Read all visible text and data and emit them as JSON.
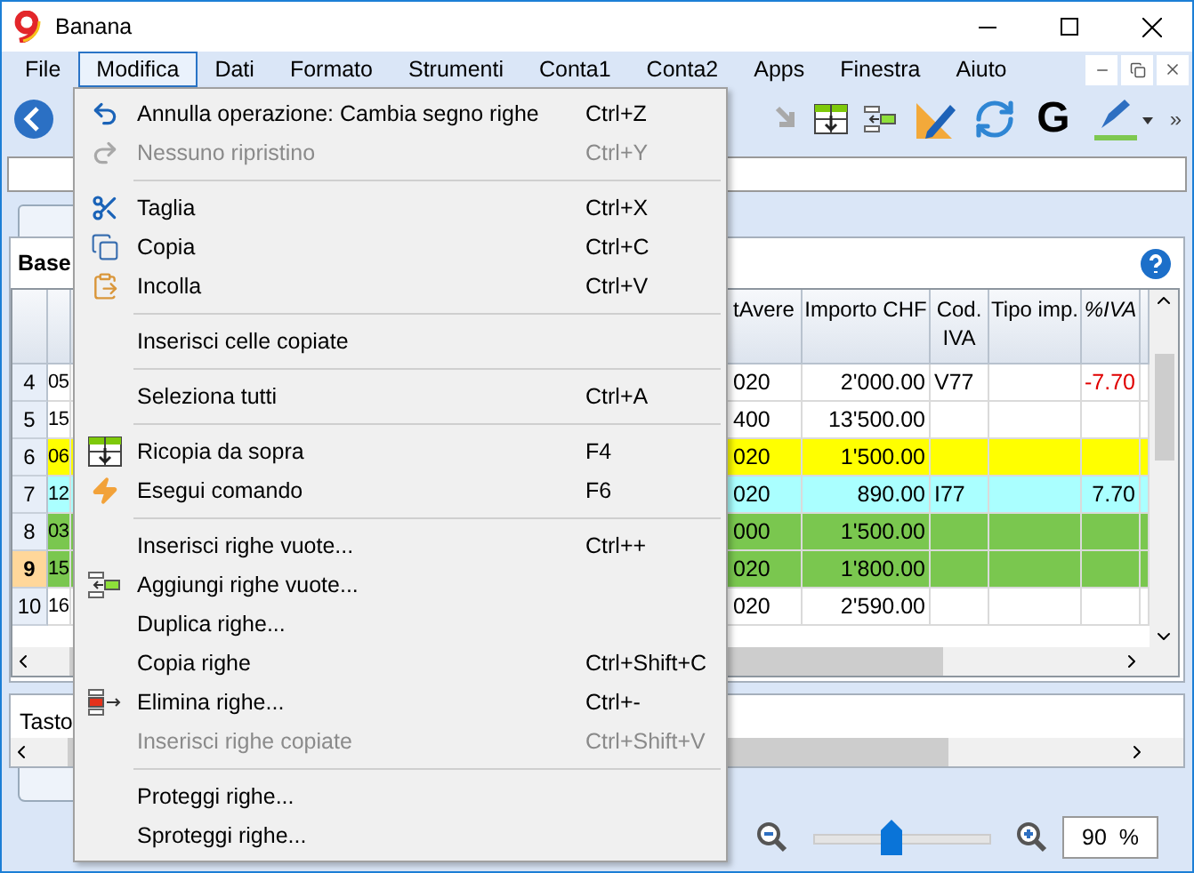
{
  "window": {
    "title": "Banana"
  },
  "menubar": [
    {
      "label": "File",
      "selected": false
    },
    {
      "label": "Modifica",
      "selected": true
    },
    {
      "label": "Dati",
      "selected": false
    },
    {
      "label": "Formato",
      "selected": false
    },
    {
      "label": "Strumenti",
      "selected": false
    },
    {
      "label": "Conta1",
      "selected": false
    },
    {
      "label": "Conta2",
      "selected": false
    },
    {
      "label": "Apps",
      "selected": false
    },
    {
      "label": "Finestra",
      "selected": false
    },
    {
      "label": "Aiuto",
      "selected": false
    }
  ],
  "toolbar": {
    "bold_label": "G",
    "more": "»"
  },
  "panel": {
    "title": "Base"
  },
  "table": {
    "columns": [
      "tAvere",
      "Importo CHF",
      "Cod. IVA",
      "Tipo imp.",
      "%IVA"
    ],
    "rows": [
      {
        "num": "4",
        "date": "05",
        "avere": "020",
        "importo": "2'000.00",
        "cod": "V77",
        "iva": "-7.70",
        "negative": true,
        "color": "#ffffff",
        "selected": false
      },
      {
        "num": "5",
        "date": "15",
        "avere": "400",
        "importo": "13'500.00",
        "color": "#ffffff",
        "selected": false
      },
      {
        "num": "6",
        "date": "06",
        "avere": "020",
        "importo": "1'500.00",
        "color": "#ffff00",
        "selected": false
      },
      {
        "num": "7",
        "date": "12",
        "avere": "020",
        "importo": "890.00",
        "cod": "I77",
        "iva": "7.70",
        "negative": false,
        "color": "#aaffff",
        "selected": false
      },
      {
        "num": "8",
        "date": "03",
        "avere": "000",
        "importo": "1'500.00",
        "color": "#7ac74f",
        "selected": false
      },
      {
        "num": "9",
        "date": "15",
        "avere": "020",
        "importo": "1'800.00",
        "color": "#7ac74f",
        "selected": true
      },
      {
        "num": "10",
        "date": "16",
        "avere": "020",
        "importo": "2'590.00",
        "color": "#ffffff",
        "selected": false
      }
    ]
  },
  "info": {
    "label": "Tasto"
  },
  "zoom": {
    "level": 0.44,
    "value": "90  %"
  },
  "menu": {
    "items": [
      {
        "kind": "item",
        "label": "Annulla operazione: Cambia segno righe",
        "shortcut": "Ctrl+Z",
        "disabled": false
      },
      {
        "kind": "item",
        "label": "Nessuno ripristino",
        "shortcut": "Ctrl+Y",
        "disabled": true
      },
      {
        "kind": "separator"
      },
      {
        "kind": "item",
        "label": "Taglia",
        "shortcut": "Ctrl+X",
        "disabled": false
      },
      {
        "kind": "item",
        "label": "Copia",
        "shortcut": "Ctrl+C",
        "disabled": false
      },
      {
        "kind": "item",
        "label": "Incolla",
        "shortcut": "Ctrl+V",
        "disabled": false
      },
      {
        "kind": "separator"
      },
      {
        "kind": "item",
        "label": "Inserisci celle copiate",
        "disabled": false
      },
      {
        "kind": "separator"
      },
      {
        "kind": "item",
        "label": "Seleziona tutti",
        "shortcut": "Ctrl+A",
        "disabled": false
      },
      {
        "kind": "separator"
      },
      {
        "kind": "item",
        "label": "Ricopia da sopra",
        "shortcut": "F4",
        "disabled": false
      },
      {
        "kind": "item",
        "label": "Esegui comando",
        "shortcut": "F6",
        "disabled": false
      },
      {
        "kind": "separator"
      },
      {
        "kind": "item",
        "label": "Inserisci righe vuote...",
        "shortcut": "Ctrl++",
        "disabled": false
      },
      {
        "kind": "item",
        "label": "Aggiungi righe vuote...",
        "disabled": false
      },
      {
        "kind": "item",
        "label": "Duplica righe...",
        "disabled": false
      },
      {
        "kind": "item",
        "label": "Copia righe",
        "shortcut": "Ctrl+Shift+C",
        "disabled": false
      },
      {
        "kind": "item",
        "label": "Elimina righe...",
        "shortcut": "Ctrl+-",
        "disabled": false
      },
      {
        "kind": "item",
        "label": "Inserisci righe copiate",
        "shortcut": "Ctrl+Shift+V",
        "disabled": true
      },
      {
        "kind": "separator"
      },
      {
        "kind": "item",
        "label": "Proteggi righe...",
        "disabled": false
      },
      {
        "kind": "item",
        "label": "Sproteggi righe...",
        "disabled": false
      }
    ]
  }
}
